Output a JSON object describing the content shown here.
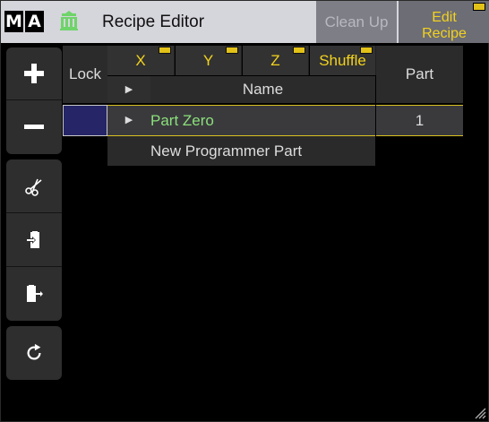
{
  "titlebar": {
    "logo_m": "M",
    "logo_a": "A",
    "icon": "recipe-pot-icon",
    "title": "Recipe Editor",
    "clean_up_label": "Clean Up",
    "edit_recipe_line1": "Edit",
    "edit_recipe_line2": "Recipe"
  },
  "toolbar": {
    "items": [
      {
        "icon": "plus-icon",
        "action": "add"
      },
      {
        "icon": "minus-icon",
        "action": "remove"
      },
      {
        "icon": "scissors-icon",
        "action": "cut"
      },
      {
        "icon": "paste-in-icon",
        "action": "insert"
      },
      {
        "icon": "paste-out-icon",
        "action": "export"
      },
      {
        "icon": "refresh-icon",
        "action": "reload"
      }
    ]
  },
  "table": {
    "lock_header": "Lock",
    "filter_columns": [
      {
        "label": "X"
      },
      {
        "label": "Y"
      },
      {
        "label": "Z"
      },
      {
        "label": "Shuffle"
      }
    ],
    "name_header": "Name",
    "part_header": "Part",
    "rows": [
      {
        "name": "Part Zero",
        "part": "1",
        "selected": true
      }
    ],
    "new_row_label": "New Programmer Part"
  },
  "colors": {
    "accent_yellow": "#f2d21e",
    "selected_name_green": "#8be07a",
    "lock_cell_blue": "#252568",
    "titlebar_bg": "#d5d5dc"
  }
}
